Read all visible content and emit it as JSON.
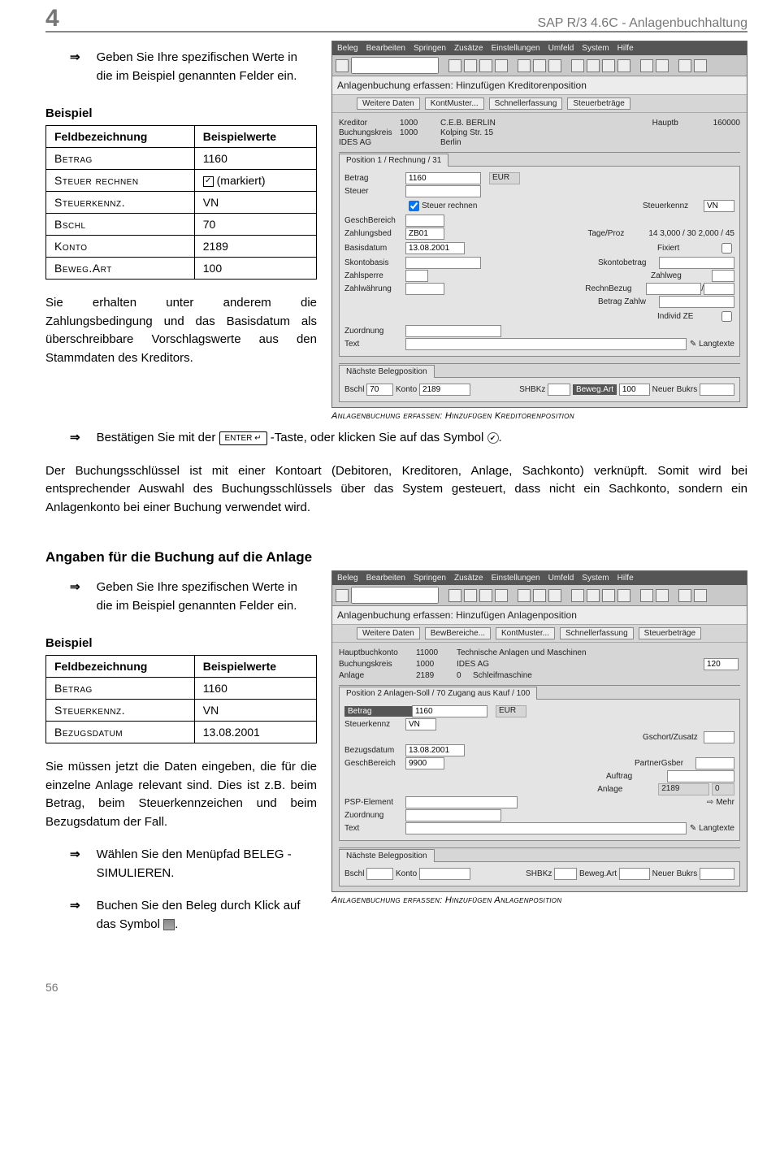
{
  "header": {
    "page_number": "4",
    "doc_title": "SAP R/3 4.6C - Anlagenbuchhaltung"
  },
  "footer": {
    "page": "56"
  },
  "intro1": "Geben Sie Ihre spezifischen Werte in die im Beispiel genannten Felder ein.",
  "beispiel_label": "Beispiel",
  "tbl1": {
    "h1": "Feldbezeichnung",
    "h2": "Beispielwerte",
    "r": [
      {
        "k": "Betrag",
        "v": "1160"
      },
      {
        "k": "Steuer rechnen",
        "v": "(markiert)"
      },
      {
        "k": "Steuerkennz.",
        "v": "VN"
      },
      {
        "k": "Bschl",
        "v": "70"
      },
      {
        "k": "Konto",
        "v": "2189"
      },
      {
        "k": "Beweg.Art",
        "v": "100"
      }
    ]
  },
  "para1": "Sie erhalten unter anderem die Zahlungsbedingung und das Basisdatum als überschreibbare Vorschlagswerte aus den Stammdaten des Kreditors.",
  "enter_line_a": "Bestätigen Sie mit der ",
  "enter_key": "ENTER ↵",
  "enter_line_b": "-Taste, oder klicken Sie auf das Symbol ",
  "para2": "Der Buchungsschlüssel ist mit einer Kontoart (Debitoren, Kreditoren, Anlage, Sachkonto) verknüpft. Somit wird bei entsprechender Auswahl des Buchungsschlüssels über das System gesteuert, dass nicht ein Sachkonto, sondern ein Anlagenkonto bei einer Buchung verwendet wird.",
  "h3": "Angaben für die Buchung auf die Anlage",
  "intro2": "Geben Sie Ihre spezifischen Werte in die im Beispiel genannten Felder ein.",
  "tbl2": {
    "h1": "Feldbezeichnung",
    "h2": "Beispielwerte",
    "r": [
      {
        "k": "Betrag",
        "v": "1160"
      },
      {
        "k": "Steuerkennz.",
        "v": "VN"
      },
      {
        "k": "Bezugsdatum",
        "v": "13.08.2001"
      }
    ]
  },
  "para3": "Sie müssen jetzt die Daten eingeben, die für die einzelne Anlage relevant sind. Dies ist z.B. beim Betrag, beim Steuerkennzeichen und beim Bezugsdatum der Fall.",
  "step_a": "Wählen Sie den Menüpfad BELEG - SIMULIEREN.",
  "step_b1": "Buchen Sie den Beleg durch Klick auf das Symbol ",
  "step_b2": ".",
  "cap1": "Anlagenbuchung erfassen: Hinzufügen Kreditorenposition",
  "cap2": "Anlagenbuchung erfassen: Hinzufügen Anlagenposition",
  "sap_shared": {
    "menu": [
      "Beleg",
      "Bearbeiten",
      "Springen",
      "Zusätze",
      "Einstellungen",
      "Umfeld",
      "System",
      "Hilfe"
    ]
  },
  "sap1": {
    "title": "Anlagenbuchung erfassen: Hinzufügen Kreditorenposition",
    "sub_buttons": [
      "Weitere Daten",
      "KontMuster...",
      "Schnellerfassung",
      "Steuerbeträge"
    ],
    "top": {
      "kreditor_l": "Kreditor",
      "kreditor": "1000",
      "kreditor_txt": "C.E.B. BERLIN",
      "hauptb_l": "Hauptb",
      "hauptb": "160000",
      "bukrs_l": "Buchungskreis",
      "bukrs": "1000",
      "bukrs_txt": "Kolping Str. 15",
      "ides_l": "IDES AG",
      "ides_txt": "Berlin"
    },
    "tab": "Position 1 / Rechnung / 31",
    "f": {
      "betrag_l": "Betrag",
      "betrag": "1160",
      "eur": "EUR",
      "steuer_l": "Steuer",
      "steuer_rechnen": "Steuer rechnen",
      "steuerkennz_l": "Steuerkennz",
      "steuerkennz": "VN",
      "gesch_l": "GeschBereich",
      "zbed_l": "Zahlungsbed",
      "zbed": "ZB01",
      "tage_l": "Tage/Proz",
      "tage": "14   3,000   /  30  2,000  /  45",
      "basis_l": "Basisdatum",
      "basis": "13.08.2001",
      "fixiert_l": "Fixiert",
      "skontobasis_l": "Skontobasis",
      "skontobetrag_l": "Skontobetrag",
      "zahlsperre_l": "Zahlsperre",
      "zahlweg_l": "Zahlweg",
      "zahlwaehrung_l": "Zahlwährung",
      "rechnbezug_l": "RechnBezug",
      "rb_sep": "/",
      "betragzahlw_l": "Betrag Zahlw",
      "individze_l": "Individ ZE",
      "zuordnung_l": "Zuordnung",
      "text_l": "Text",
      "langtexte": "Langtexte"
    },
    "next_tab": "Nächste Belegposition",
    "next": {
      "bschl_l": "Bschl",
      "bschl": "70",
      "konto_l": "Konto",
      "konto": "2189",
      "shbkz_l": "SHBKz",
      "bewart_l": "Beweg.Art",
      "bewart": "100",
      "neuer_l": "Neuer Bukrs"
    }
  },
  "sap2": {
    "title": "Anlagenbuchung erfassen: Hinzufügen Anlagenposition",
    "sub_buttons": [
      "Weitere Daten",
      "BewBereiche...",
      "KontMuster...",
      "Schnellerfassung",
      "Steuerbeträge"
    ],
    "top": {
      "hbk_l": "Hauptbuchkonto",
      "hbk": "11000",
      "hbk_txt": "Technische Anlagen und Maschinen",
      "bukrs_l": "Buchungskreis",
      "bukrs": "1000",
      "ides": "IDES AG",
      "extra": "120",
      "anlage_l": "Anlage",
      "anlage": "2189",
      "anlage_u": "0",
      "anlage_txt": "Schleifmaschine"
    },
    "tab": "Position 2 Anlagen-Soll / 70 Zugang aus Kauf / 100",
    "f": {
      "betrag_l": "Betrag",
      "betrag": "1160",
      "eur": "EUR",
      "steuerkennz_l": "Steuerkennz",
      "steuerkennz": "VN",
      "gschort_l": "Gschort/Zusatz",
      "bezug_l": "Bezugsdatum",
      "bezug": "13.08.2001",
      "gesch_l": "GeschBereich",
      "gesch": "9900",
      "partner_l": "PartnerGsber",
      "auftrag_l": "Auftrag",
      "anlage_l": "Anlage",
      "anlage": "2189",
      "anlage_u": "0",
      "psp_l": "PSP-Element",
      "mehr": "Mehr",
      "zuordnung_l": "Zuordnung",
      "text_l": "Text",
      "langtexte": "Langtexte"
    },
    "next_tab": "Nächste Belegposition",
    "next": {
      "bschl_l": "Bschl",
      "konto_l": "Konto",
      "shbkz_l": "SHBKz",
      "bewart_l": "Beweg.Art",
      "neuer_l": "Neuer Bukrs"
    }
  }
}
